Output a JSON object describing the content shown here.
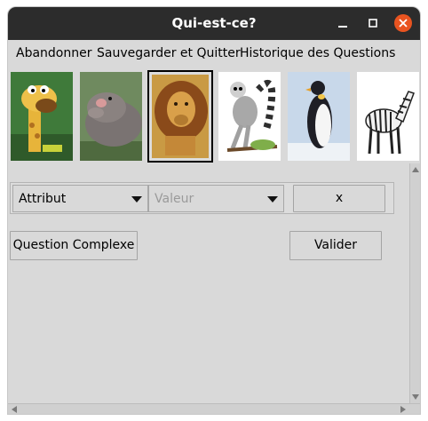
{
  "window": {
    "title": "Qui-est-ce?"
  },
  "menu": {
    "items": [
      {
        "label": "Abandonner"
      },
      {
        "label": "Sauvegarder et Quitter"
      },
      {
        "label": "Historique des Questions"
      }
    ]
  },
  "gallery": {
    "animals": [
      {
        "name": "giraffe"
      },
      {
        "name": "hippo"
      },
      {
        "name": "lion",
        "selected": true
      },
      {
        "name": "lemur"
      },
      {
        "name": "penguin"
      },
      {
        "name": "zebra"
      }
    ]
  },
  "question": {
    "attribute_value": "Attribut",
    "value_placeholder": "Valeur",
    "remove_label": "x",
    "complex_label": "Question Complexe",
    "validate_label": "Valider"
  }
}
